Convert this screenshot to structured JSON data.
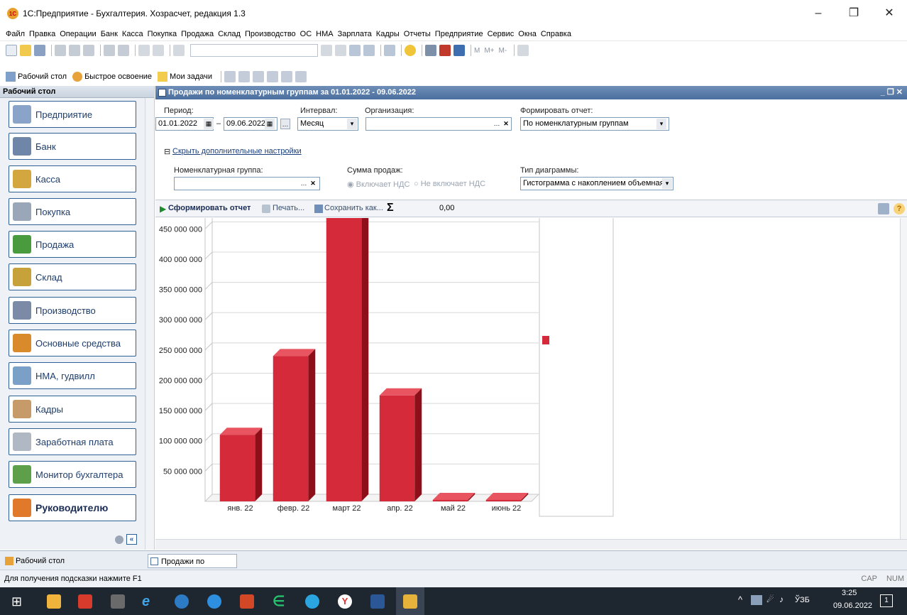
{
  "window": {
    "title": "1С:Предприятие - Бухгалтерия. Хозрасчет, редакция 1.3",
    "logo_text": "1C"
  },
  "menu": [
    "Файл",
    "Правка",
    "Операции",
    "Банк",
    "Касса",
    "Покупка",
    "Продажа",
    "Склад",
    "Производство",
    "ОС",
    "НМА",
    "Зарплата",
    "Кадры",
    "Отчеты",
    "Предприятие",
    "Сервис",
    "Окна",
    "Справка"
  ],
  "toolbar2": {
    "desktop": "Рабочий стол",
    "quick": "Быстрое освоение",
    "tasks": "Мои задачи"
  },
  "toolbar1": {
    "mem_labels": [
      "M",
      "M+",
      "M-"
    ]
  },
  "left_panel": {
    "title": "Рабочий стол",
    "items": [
      "Предприятие",
      "Банк",
      "Касса",
      "Покупка",
      "Продажа",
      "Склад",
      "Производство",
      "Основные средства",
      "НМА, гудвилл",
      "Кадры",
      "Заработная плата",
      "Монитор бухгалтера",
      "Руководителю"
    ],
    "icon_colors": [
      "#8aa3c8",
      "#6f86a8",
      "#d4a640",
      "#9aa7b8",
      "#4a9a3e",
      "#c7a23a",
      "#7b8aa6",
      "#d98a2b",
      "#7aa0c8",
      "#c79a6a",
      "#b0b8c4",
      "#5ea04a",
      "#e07a2a"
    ]
  },
  "report": {
    "title": "Продажи по номенклатурным группам за 01.01.2022 - 09.06.2022",
    "period_label": "Период:",
    "period_from": "01.01.2022",
    "period_to": "09.06.2022",
    "interval_label": "Интервал:",
    "interval_value": "Месяц",
    "org_label": "Организация:",
    "org_value": "",
    "form_label": "Формировать отчет:",
    "form_value": "По номенклатурным группам",
    "hide_settings": "Скрыть дополнительные настройки",
    "nomgroup_label": "Номенклатурная группа:",
    "nomgroup_value": "",
    "sum_label": "Сумма продаж:",
    "sum_opt1": "Включает НДС",
    "sum_opt2": "Не включает НДС",
    "chart_type_label": "Тип диаграммы:",
    "chart_type_value": "Гистограмма с накоплением объемная",
    "btn_generate": "Сформировать отчет",
    "btn_print": "Печать...",
    "btn_save": "Сохранить как...",
    "sigma": "Σ",
    "sum_total": "0,00"
  },
  "chart_data": {
    "type": "bar",
    "categories": [
      "янв. 22",
      "февр. 22",
      "март 22",
      "апр. 22",
      "май 22",
      "июнь 22"
    ],
    "values": [
      110000000,
      240000000,
      475000000,
      175000000,
      0,
      0
    ],
    "ylim": [
      0,
      475000000
    ],
    "yticks": [
      50000000,
      100000000,
      150000000,
      200000000,
      250000000,
      300000000,
      350000000,
      400000000,
      450000000
    ],
    "ytick_labels": [
      "50 000 000",
      "100 000 000",
      "150 000 000",
      "200 000 000",
      "250 000 000",
      "300 000 000",
      "350 000 000",
      "400 000 000",
      "450 000 000"
    ],
    "legend": "right",
    "color": "#d42a3a",
    "title": "",
    "xlabel": "",
    "ylabel": ""
  },
  "tabs": [
    "Рабочий стол",
    "Продажи по номенклатурн..."
  ],
  "status": {
    "hint": "Для получения подсказки нажмите F1",
    "cap": "CAP",
    "num": "NUM"
  },
  "taskbar": {
    "lang": "ЎЗБ",
    "time": "3:25",
    "date": "09.06.2022",
    "notif_count": "1"
  }
}
